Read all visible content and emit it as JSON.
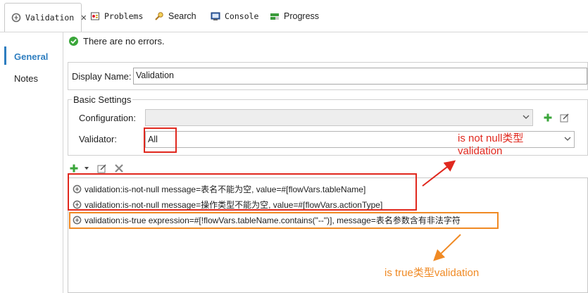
{
  "tabs": [
    {
      "label": "Validation",
      "active": true,
      "icon": "validation-icon"
    },
    {
      "label": "Problems",
      "icon": "problems-icon"
    },
    {
      "label": "Search",
      "icon": "search-icon"
    },
    {
      "label": "Console",
      "icon": "console-icon"
    },
    {
      "label": "Progress",
      "icon": "progress-icon"
    }
  ],
  "sidebar": {
    "items": [
      {
        "label": "General",
        "selected": true
      },
      {
        "label": "Notes"
      }
    ]
  },
  "status_message": "There are no errors.",
  "display_name": {
    "label": "Display Name:",
    "value": "Validation"
  },
  "basic_settings": {
    "title": "Basic Settings",
    "configuration_label": "Configuration:",
    "configuration_value": "",
    "validator_label": "Validator:",
    "validator_value": "All"
  },
  "validations": [
    "validation:is-not-null message=表名不能为空, value=#[flowVars.tableName]",
    "validation:is-not-null message=操作类型不能为空, value=#[flowVars.actionType]",
    "validation:is-true expression=#[!flowVars.tableName.contains(\"--\")], message=表名参数含有非法字符"
  ],
  "annotations": {
    "not_null_line1": "is not null类型",
    "not_null_line2": "validation",
    "is_true": "is true类型validation"
  },
  "colors": {
    "accent": "#2e7ec0",
    "annotation_red": "#e0281e",
    "annotation_orange": "#f08a24",
    "success": "#3aa63a"
  }
}
